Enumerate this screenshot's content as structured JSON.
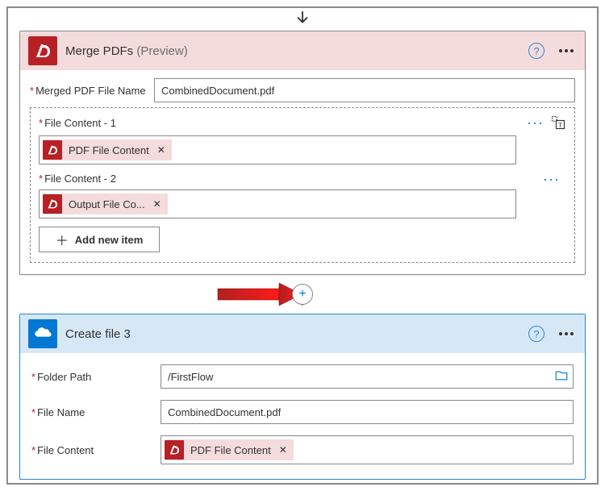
{
  "merge_card": {
    "title": "Merge PDFs",
    "preview_suffix": "(Preview)",
    "merged_file_label": "Merged PDF File Name",
    "merged_file_value": "CombinedDocument.pdf",
    "file_content_1_label": "File Content - 1",
    "file_content_1_token": "PDF File Content",
    "file_content_2_label": "File Content - 2",
    "file_content_2_token": "Output File Co...",
    "add_new_item_label": "Add new item"
  },
  "create_card": {
    "title": "Create file 3",
    "folder_path_label": "Folder Path",
    "folder_path_value": "/FirstFlow",
    "file_name_label": "File Name",
    "file_name_value": "CombinedDocument.pdf",
    "file_content_label": "File Content",
    "file_content_token": "PDF File Content"
  }
}
